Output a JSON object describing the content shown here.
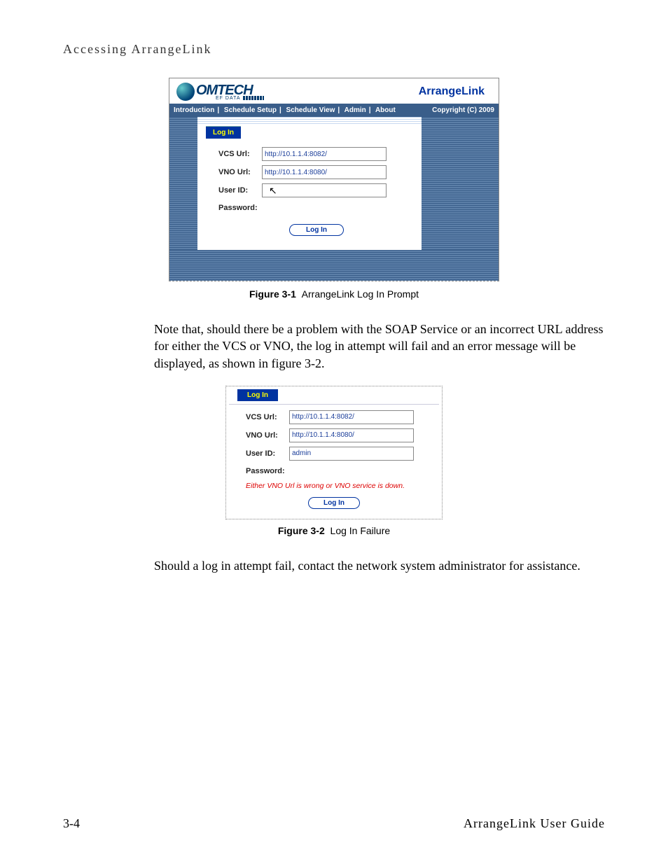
{
  "header": {
    "section_title": "Accessing ArrangeLink"
  },
  "screenshot1": {
    "product": "ArrangeLink",
    "logo_text": "OMTECH",
    "logo_sub": "EF DATA",
    "nav": {
      "items": [
        "Introduction",
        "Schedule Setup",
        "Schedule View",
        "Admin",
        "About"
      ],
      "copyright": "Copyright (C) 2009"
    },
    "login_tab": "Log In",
    "labels": {
      "vcs": "VCS Url:",
      "vno": "VNO Url:",
      "userid": "User ID:",
      "password": "Password:"
    },
    "values": {
      "vcs": "http://10.1.1.4:8082/",
      "vno": "http://10.1.1.4:8080/",
      "userid": "",
      "password": ""
    },
    "login_btn": "Log In"
  },
  "caption1_label": "Figure 3-1",
  "caption1_text": "ArrangeLink Log In Prompt",
  "para1": "Note that, should there be a problem with the SOAP Service or an incorrect URL address for either the VCS or VNO, the log in attempt will fail and an error message will be displayed, as shown in figure 3-2.",
  "screenshot2": {
    "login_tab": "Log In",
    "labels": {
      "vcs": "VCS Url:",
      "vno": "VNO Url:",
      "userid": "User ID:",
      "password": "Password:"
    },
    "values": {
      "vcs": "http://10.1.1.4:8082/",
      "vno": "http://10.1.1.4:8080/",
      "userid": "admin",
      "password": ""
    },
    "error": "Either VNO Url is wrong or VNO service is down.",
    "login_btn": "Log In"
  },
  "caption2_label": "Figure 3-2",
  "caption2_text": "Log In Failure",
  "para2": "Should a log in attempt fail, contact the network system administrator for assistance.",
  "footer": {
    "page": "3-4",
    "title": "ArrangeLink User Guide"
  }
}
